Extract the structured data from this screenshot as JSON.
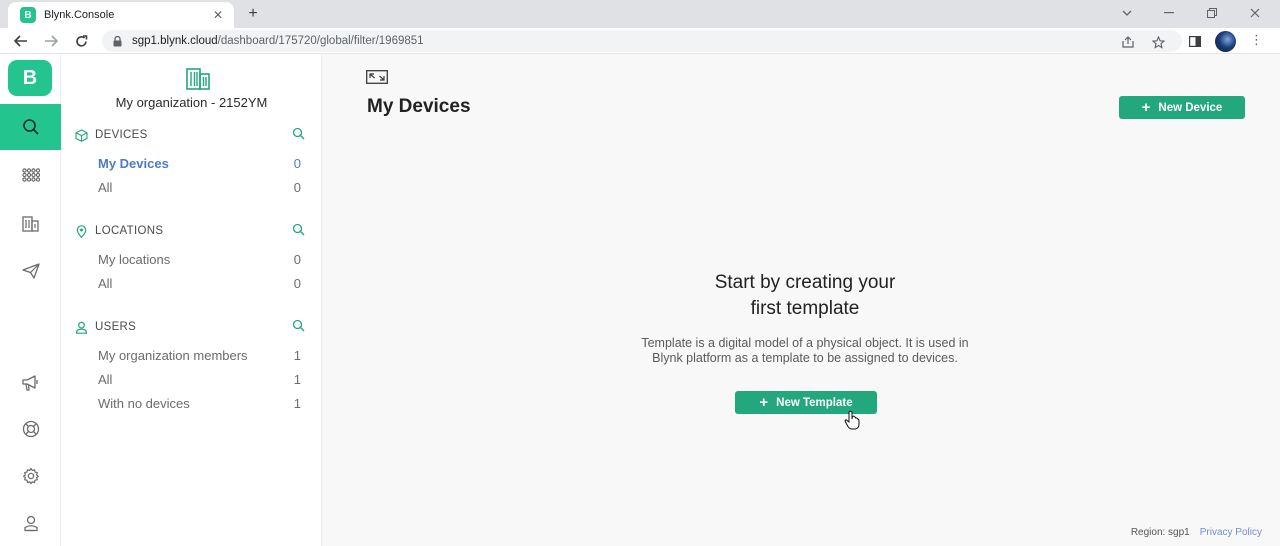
{
  "browser": {
    "tab_title": "Blynk.Console",
    "tab_close": "✕",
    "new_tab": "+",
    "url_host": "sgp1.blynk.cloud",
    "url_path": "/dashboard/175720/global/filter/1969851"
  },
  "rail": {
    "logo_letter": "B"
  },
  "sidebar": {
    "org_name": "My organization - 2152YM",
    "sections": {
      "devices": {
        "title": "DEVICES",
        "items": [
          {
            "label": "My Devices",
            "count": "0"
          },
          {
            "label": "All",
            "count": "0"
          }
        ]
      },
      "locations": {
        "title": "LOCATIONS",
        "items": [
          {
            "label": "My locations",
            "count": "0"
          },
          {
            "label": "All",
            "count": "0"
          }
        ]
      },
      "users": {
        "title": "USERS",
        "items": [
          {
            "label": "My organization members",
            "count": "1"
          },
          {
            "label": "All",
            "count": "1"
          },
          {
            "label": "With no devices",
            "count": "1"
          }
        ]
      }
    }
  },
  "main": {
    "title": "My Devices",
    "new_device_label": "New Device",
    "empty_title_line1": "Start by creating your",
    "empty_title_line2": "first template",
    "empty_description": "Template is a digital model of a physical object. It is used in Blynk platform as a template to be assigned to devices.",
    "new_template_label": "New Template"
  },
  "footer": {
    "region": "Region: sgp1",
    "privacy": "Privacy Policy"
  },
  "colors": {
    "brand": "#23c48e",
    "button": "#23a77d",
    "selected_item": "#4d7cc7"
  }
}
